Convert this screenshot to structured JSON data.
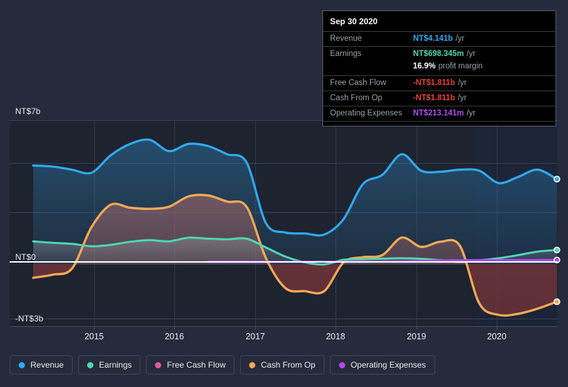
{
  "chart_data": {
    "type": "area",
    "title": "",
    "xlabel": "",
    "ylabel": "",
    "currency": "NT$",
    "grid": true,
    "legend_position": "bottom",
    "x": [
      "2015",
      "2016",
      "2017",
      "2018",
      "2019",
      "2020"
    ],
    "xlim": [
      "2014.3",
      "2020.9"
    ],
    "ylim": [
      -3,
      7
    ],
    "y_ticks": [
      {
        "label": "NT$7b",
        "value": 7
      },
      {
        "label": "NT$0",
        "value": 0
      },
      {
        "label": "-NT$3b",
        "value": -3
      }
    ],
    "series": [
      {
        "name": "Revenue",
        "color": "#31a9f0",
        "unit": "b",
        "values": [
          4.8,
          4.75,
          4.6,
          4.45,
          5.3,
          5.85,
          6.05,
          5.5,
          5.85,
          5.75,
          5.35,
          4.95,
          2.0,
          1.55,
          1.5,
          1.45,
          2.2,
          3.9,
          4.35,
          5.35,
          4.55,
          4.5,
          4.6,
          4.55,
          3.95,
          4.25,
          4.6,
          4.141
        ],
        "end_value": 4.141
      },
      {
        "name": "Earnings",
        "color": "#4dd6b4",
        "unit": "b",
        "values": [
          1.12,
          1.05,
          1.0,
          0.88,
          0.95,
          1.1,
          1.18,
          1.12,
          1.3,
          1.25,
          1.22,
          1.25,
          0.82,
          0.38,
          0.1,
          0.0,
          0.22,
          0.25,
          0.28,
          0.3,
          0.27,
          0.2,
          0.12,
          0.2,
          0.3,
          0.45,
          0.62,
          0.698345
        ],
        "end_value": 0.698345
      },
      {
        "name": "Free Cash Flow",
        "color": "#e05a8f",
        "unit": "b",
        "values": [
          -0.65,
          -0.5,
          -0.2,
          1.8,
          2.9,
          2.75,
          2.7,
          2.8,
          3.3,
          3.35,
          3.05,
          2.8,
          0.3,
          -1.15,
          -1.3,
          -1.3,
          0.1,
          0.35,
          0.45,
          1.3,
          0.85,
          1.1,
          0.9,
          -1.9,
          -2.45,
          -2.4,
          -2.15,
          -1.811
        ],
        "end_value": -1.811
      },
      {
        "name": "Cash From Op",
        "color": "#f0ab53",
        "unit": "b",
        "values": [
          -0.65,
          -0.5,
          -0.2,
          1.8,
          2.9,
          2.75,
          2.7,
          2.8,
          3.3,
          3.35,
          3.05,
          2.8,
          0.3,
          -1.15,
          -1.3,
          -1.3,
          0.1,
          0.35,
          0.45,
          1.3,
          0.85,
          1.1,
          0.9,
          -1.9,
          -2.45,
          -2.4,
          -2.15,
          -1.811
        ],
        "end_value": -1.811
      },
      {
        "name": "Operating Expenses",
        "color": "#ac4df0",
        "unit": "m",
        "values": [
          0.14,
          0.14,
          0.14,
          0.14,
          0.14,
          0.14,
          0.13,
          0.13,
          0.13,
          0.13,
          0.13,
          0.13,
          0.13,
          0.13,
          0.13,
          0.13,
          0.13,
          0.13,
          0.14,
          0.15,
          0.17,
          0.19,
          0.2,
          0.21,
          0.21,
          0.21,
          0.21,
          0.213141
        ],
        "start_index": 9,
        "end_value": 0.213141
      }
    ]
  },
  "tooltip": {
    "date": "Sep 30 2020",
    "rows": [
      {
        "label": "Revenue",
        "value": "NT$4.141b",
        "unit": "/yr",
        "color": "#31a9f0"
      },
      {
        "label": "Earnings",
        "value": "NT$698.345m",
        "unit": "/yr",
        "color": "#4dd6b4"
      },
      {
        "label": "",
        "value": "16.9%",
        "unit": "profit margin",
        "color": "#ffffff",
        "sub": true
      },
      {
        "label": "Free Cash Flow",
        "value": "-NT$1.811b",
        "unit": "/yr",
        "color": "#e8413a"
      },
      {
        "label": "Cash From Op",
        "value": "-NT$1.811b",
        "unit": "/yr",
        "color": "#e8413a"
      },
      {
        "label": "Operating Expenses",
        "value": "NT$213.141m",
        "unit": "/yr",
        "color": "#ac4df0"
      }
    ]
  },
  "legend": {
    "items": [
      {
        "label": "Revenue",
        "color": "#31a9f0"
      },
      {
        "label": "Earnings",
        "color": "#4dd6b4"
      },
      {
        "label": "Free Cash Flow",
        "color": "#e05a8f"
      },
      {
        "label": "Cash From Op",
        "color": "#f0ab53"
      },
      {
        "label": "Operating Expenses",
        "color": "#ac4df0"
      }
    ]
  }
}
